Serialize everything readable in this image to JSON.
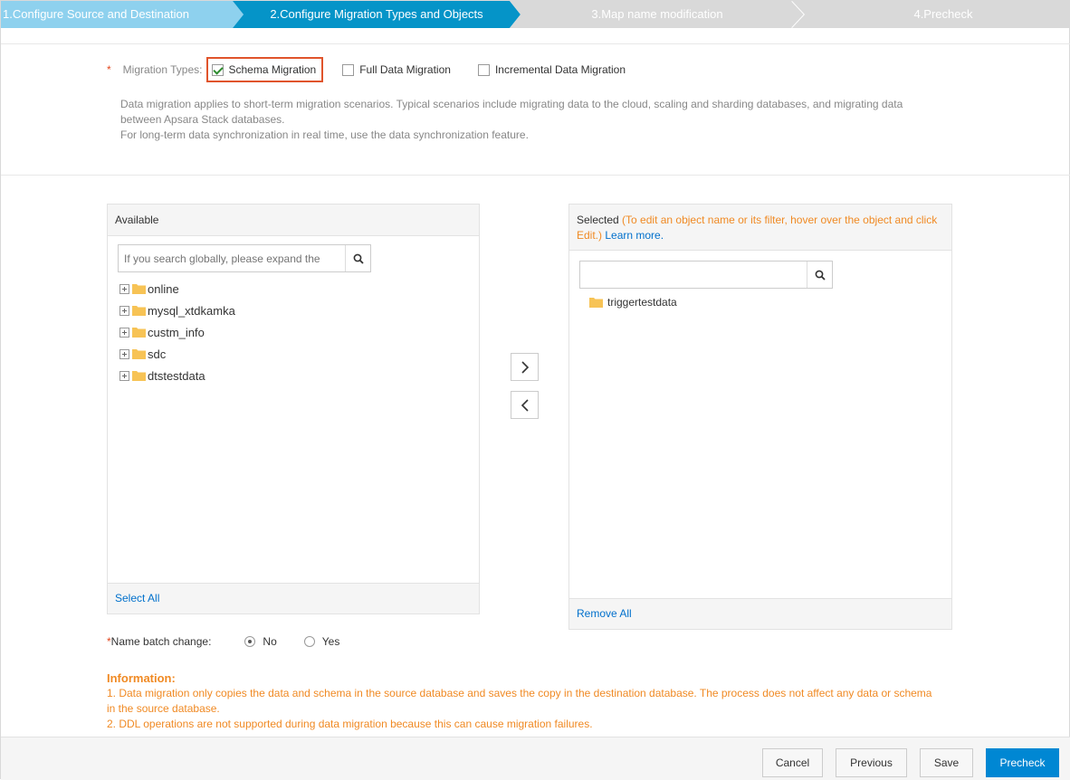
{
  "steps": [
    {
      "label": "1.Configure Source and Destination",
      "state": "done",
      "color": "#8ed1ee"
    },
    {
      "label": "2.Configure Migration Types and Objects",
      "state": "active",
      "color": "#0594c8"
    },
    {
      "label": "3.Map name modification",
      "state": "pending",
      "color": "#d9d9d9"
    },
    {
      "label": "4.Precheck",
      "state": "pending",
      "color": "#d9d9d9"
    }
  ],
  "migration_types": {
    "required_mark": "*",
    "label": "Migration Types:",
    "options": [
      {
        "label": "Schema Migration",
        "checked": true
      },
      {
        "label": "Full Data Migration",
        "checked": false
      },
      {
        "label": "Incremental Data Migration",
        "checked": false
      }
    ],
    "description_1": "Data migration applies to short-term migration scenarios. Typical scenarios include migrating data to the cloud, scaling and sharding databases, and migrating data between Apsara Stack databases.",
    "description_2": "For long-term data synchronization in real time, use the data synchronization feature."
  },
  "available": {
    "title": "Available",
    "search_placeholder": "If you search globally, please expand the",
    "items": [
      "online",
      "mysql_xtdkamka",
      "custm_info",
      "sdc",
      "dtstestdata"
    ],
    "select_all": "Select All"
  },
  "selected": {
    "title": "Selected",
    "hint": "(To edit an object name or its filter, hover over the object and click Edit.)",
    "learn_more": "Learn more.",
    "search_placeholder": "",
    "items": [
      "triggertestdata"
    ],
    "remove_all": "Remove All"
  },
  "name_batch_change": {
    "required_mark": "*",
    "label": "Name batch change:",
    "options": [
      {
        "label": "No",
        "selected": true
      },
      {
        "label": "Yes",
        "selected": false
      }
    ]
  },
  "information": {
    "title": "Information:",
    "line_1": "1. Data migration only copies the data and schema in the source database and saves the copy in the destination database. The process does not affect any data or schema in the source database.",
    "line_2": "2. DDL operations are not supported during data migration because this can cause migration failures."
  },
  "footer": {
    "cancel": "Cancel",
    "previous": "Previous",
    "save": "Save",
    "precheck": "Precheck"
  },
  "colors": {
    "accent": "#0594c8",
    "primary_button": "#0087d3",
    "warning_text": "#f08a24",
    "highlight_box": "#e0542c",
    "link": "#0070cc"
  }
}
